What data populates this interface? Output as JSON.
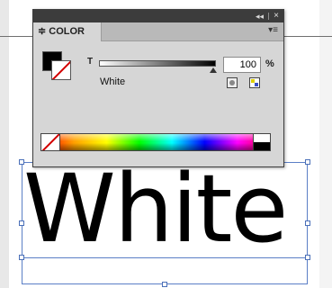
{
  "panel": {
    "collapse_glyph": "◂◂",
    "close_glyph": "×",
    "tab_label": "≑ COLOR",
    "menu_glyph": "▾≡",
    "tint": {
      "label": "T",
      "value": "100",
      "unit": "%",
      "level_percent": 100
    },
    "swatch_name": "White",
    "fill_color": "#000000",
    "stroke": "none",
    "icons": [
      "rgb-mode-icon",
      "cmyk-mode-icon"
    ]
  },
  "canvas": {
    "text": "White",
    "frame_color": "#5b7fc6"
  }
}
